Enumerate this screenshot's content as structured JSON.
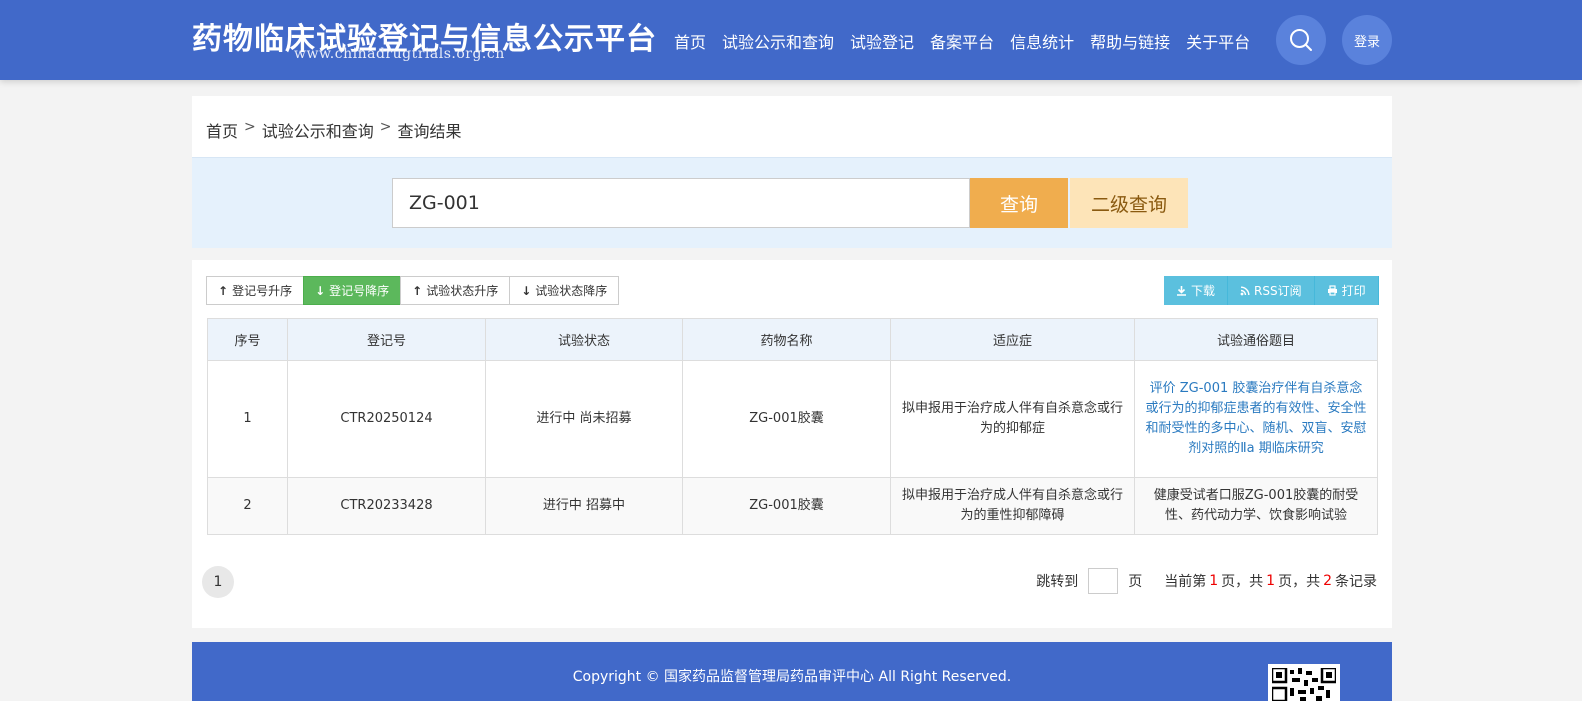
{
  "header": {
    "title": "药物临床试验登记与信息公示平台",
    "url": "www.chinadrugtrials.org.cn",
    "nav": [
      "首页",
      "试验公示和查询",
      "试验登记",
      "备案平台",
      "信息统计",
      "帮助与链接",
      "关于平台"
    ],
    "login": "登录"
  },
  "breadcrumb": [
    "首页",
    "试验公示和查询",
    "查询结果"
  ],
  "breadcrumb_sep": ">",
  "search": {
    "value": "ZG-001",
    "query_button": "查询",
    "advanced_button": "二级查询"
  },
  "sort_buttons": [
    "登记号升序",
    "登记号降序",
    "试验状态升序",
    "试验状态降序"
  ],
  "action_buttons": [
    "下载",
    "RSS订阅",
    "打印"
  ],
  "table": {
    "headers": [
      "序号",
      "登记号",
      "试验状态",
      "药物名称",
      "适应症",
      "试验通俗题目"
    ],
    "rows": [
      {
        "no": "1",
        "reg_no": "CTR20250124",
        "status": "进行中 尚未招募",
        "drug": "ZG-001胶囊",
        "indication": "拟申报用于治疗成人伴有自杀意念或行为的抑郁症",
        "title": "评价 ZG-001 胶囊治疗伴有自杀意念或行为的抑郁症患者的有效性、安全性 和耐受性的多中心、随机、双盲、安慰剂对照的Ⅱa 期临床研究"
      },
      {
        "no": "2",
        "reg_no": "CTR20233428",
        "status": "进行中 招募中",
        "drug": "ZG-001胶囊",
        "indication": "拟申报用于治疗成人伴有自杀意念或行为的重性抑郁障碍",
        "title": "健康受试者口服ZG-001胶囊的耐受性、药代动力学、饮食影响试验"
      }
    ]
  },
  "pagination": {
    "page_button": "1",
    "jump_to": "跳转到",
    "page_unit": "页",
    "current_prefix": "当前第",
    "current_page": "1",
    "page_mid": "页，共",
    "total_pages": "1",
    "records_mid": "页，共",
    "total_records": "2",
    "records_suffix": "条记录"
  },
  "footer": {
    "copyright": "Copyright © 国家药品监督管理局药品审评中心 All Right Reserved."
  }
}
